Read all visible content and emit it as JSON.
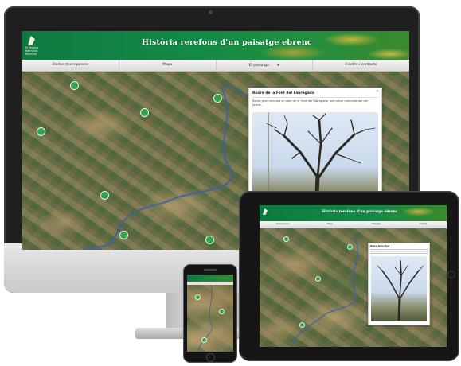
{
  "desktop": {
    "logo_text": "El Moleta\nMemòria\nRecerca",
    "banner_title": "Història rerefons d'un paisatge ebrenc",
    "nav": [
      {
        "label": "Dades descripcions"
      },
      {
        "label": "Mapa"
      },
      {
        "label": "El paisatge",
        "has_dropdown": true
      },
      {
        "label": "Crèdits i contacte"
      }
    ],
    "popup": {
      "title": "Roure de la Font del Fàbregada",
      "description": "Roure gran vinculat al camí de la Font del Fàbregada, vell arbre monumental del terme.",
      "close_glyph": "×"
    }
  },
  "tablet": {
    "banner_title": "Història rerefons d'un paisatge ebrenc",
    "nav": [
      "Descripcions",
      "Mapa",
      "Paisatge",
      "Crèdits"
    ],
    "popup_title": "Roure de la Font"
  },
  "colors": {
    "banner_green": "#148a47",
    "pin_green": "#2fa44a",
    "river_blue": "#3d5fa8"
  },
  "icons": [
    "leaf-logo-icon",
    "map-marker-icon",
    "close-icon",
    "chevron-down-icon",
    "home-button-icon"
  ]
}
